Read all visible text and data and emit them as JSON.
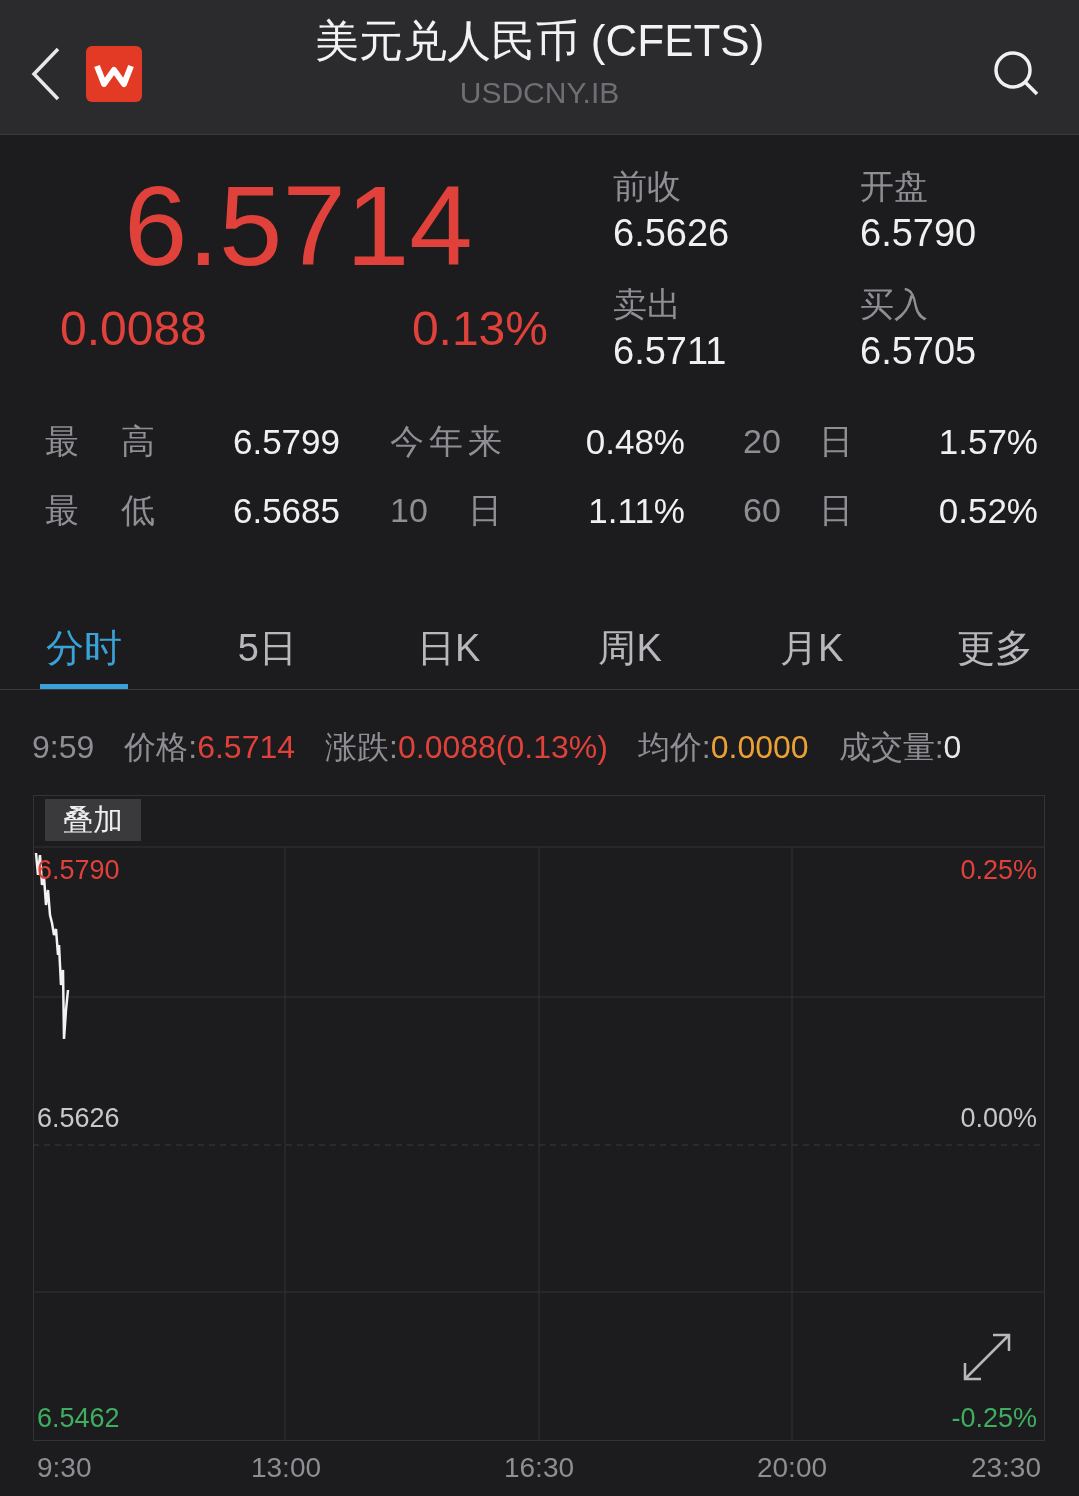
{
  "header": {
    "title": "美元兑人民币 (CFETS)",
    "subtitle": "USDCNY.IB"
  },
  "quote": {
    "price": "6.5714",
    "change": "0.0088",
    "change_pct": "0.13%",
    "fields": [
      {
        "label": "前收",
        "value": "6.5626"
      },
      {
        "label": "开盘",
        "value": "6.5790"
      },
      {
        "label": "卖出",
        "value": "6.5711"
      },
      {
        "label": "买入",
        "value": "6.5705"
      }
    ]
  },
  "stats": [
    [
      {
        "label": "最 高",
        "value": "6.5799"
      },
      {
        "label": "今年来",
        "value": "0.48%"
      },
      {
        "label": "20 日",
        "value": "1.57%"
      }
    ],
    [
      {
        "label": "最 低",
        "value": "6.5685"
      },
      {
        "label": "10 日",
        "value": "1.11%"
      },
      {
        "label": "60 日",
        "value": "0.52%"
      }
    ]
  ],
  "tabs": [
    {
      "label": "分时",
      "selected": true
    },
    {
      "label": "5日",
      "selected": false
    },
    {
      "label": "日K",
      "selected": false
    },
    {
      "label": "周K",
      "selected": false
    },
    {
      "label": "月K",
      "selected": false
    },
    {
      "label": "更多",
      "selected": false
    }
  ],
  "info": {
    "time": "9:59",
    "items": [
      {
        "label": "价格:",
        "value": "6.5714",
        "color": "#e0413a"
      },
      {
        "label": "涨跌:",
        "value": "0.0088(0.13%)",
        "color": "#e0413a"
      },
      {
        "label": "均价:",
        "value": "0.0000",
        "color": "#eba134"
      },
      {
        "label": "成交量:",
        "value": "0",
        "color": "#e8e8e8"
      }
    ]
  },
  "chart": {
    "overlay_button": "叠加",
    "left_labels": [
      {
        "text": "6.5790",
        "kind": "up"
      },
      {
        "text": "6.5626",
        "kind": "flat"
      },
      {
        "text": "6.5462",
        "kind": "down"
      }
    ],
    "right_labels": [
      {
        "text": "0.25%",
        "kind": "up"
      },
      {
        "text": "0.00%",
        "kind": "flat"
      },
      {
        "text": "-0.25%",
        "kind": "down"
      }
    ],
    "times": [
      "9:30",
      "13:00",
      "16:30",
      "20:00",
      "23:30"
    ]
  }
}
